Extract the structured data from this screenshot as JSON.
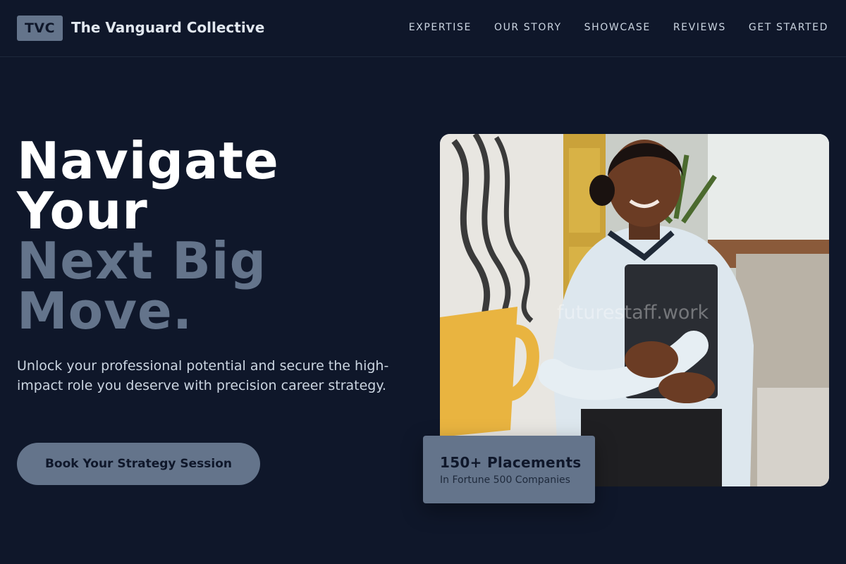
{
  "header": {
    "logo_text": "TVC",
    "brand_name": "The Vanguard Collective",
    "nav": [
      "EXPERTISE",
      "OUR STORY",
      "SHOWCASE",
      "REVIEWS",
      "GET STARTED"
    ]
  },
  "hero": {
    "headline_line1": "Navigate",
    "headline_line2": "Your",
    "headline_line3": "Next Big",
    "headline_line4": "Move.",
    "subtext": "Unlock your professional potential and secure the high-impact role you deserve with precision career strategy.",
    "cta_label": "Book Your Strategy Session"
  },
  "image": {
    "watermark": "futurestaff.work"
  },
  "stat_card": {
    "title": "150+ Placements",
    "subtitle": "In Fortune 500 Companies"
  },
  "colors": {
    "background": "#0f172a",
    "accent": "#64748b",
    "text_light": "#cbd5e1"
  }
}
